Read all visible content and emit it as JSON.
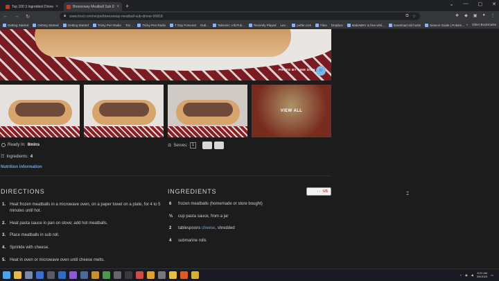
{
  "browser": {
    "tabs": [
      {
        "title": "Top 100 3 Ingredient Dinners | Gen",
        "active": false
      },
      {
        "title": "Breezeway Meatball Sub Dinne",
        "active": true
      }
    ],
    "url": "www.food.com/recipe/breezeway-meatball-sub-dinner-90818",
    "bookmarks": [
      "Getting Started",
      "Getting Started",
      "Getting Started",
      "Tricky Pen Radio",
      "Tric...",
      "Tricky Pen Radio",
      "T Day Forecast",
      "Outl...",
      "Tabsonic: InfoTub...",
      "Recently Played",
      "Lev...",
      "potfer.com",
      "Files",
      "Dropbox",
      "MakeMKV is free whil...",
      "Download old hosts",
      "Season Guide | Pokém..."
    ],
    "other_bookmarks": "Other Bookmarks"
  },
  "hero": {
    "credit": "PHOTO BY DINE DISH"
  },
  "gallery": {
    "view_all": "VIEW ALL"
  },
  "meta": {
    "ready_label": "Ready In:",
    "ready_value": "8mins",
    "serves_label": "Serves:",
    "serves_value": "1",
    "ingredients_label": "Ingredients:",
    "ingredients_value": "4",
    "nutrition_link": "Nutrition information"
  },
  "directions": {
    "heading": "DIRECTIONS",
    "steps": [
      "Heat frozen meatballs in a microwave oven, on a paper towel on a plate, for 4 to 5 minutes until hot.",
      "Heat pasta sauce in pan on stove; add hot meatballs.",
      "Place meatballs in sub roll.",
      "Sprinkle with cheese.",
      "Heat in oven or microwave oven until cheese melts."
    ]
  },
  "ingredients": {
    "heading": "INGREDIENTS",
    "units_toggle": "US",
    "items": [
      {
        "qty": "6",
        "text": "frozen meatballs (homemade or store bought)"
      },
      {
        "qty": "⅓",
        "text": "cup pasta sauce, from a jar"
      },
      {
        "qty": "2",
        "pre": "tablespoons ",
        "link": "cheese",
        "post": ", shredded"
      },
      {
        "qty": "4",
        "text": "submarine rolls"
      }
    ]
  },
  "taskbar": {
    "time": "8:22 AM",
    "date": "3/9/2023"
  }
}
